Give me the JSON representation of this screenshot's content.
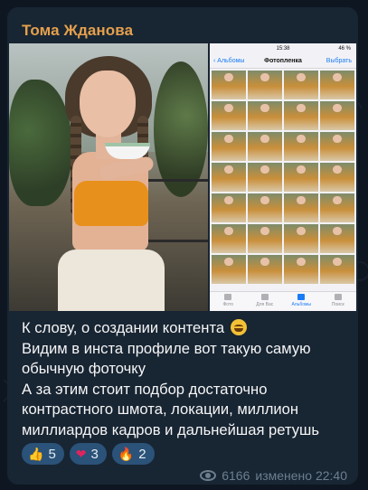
{
  "post": {
    "author": "Тома Жданова",
    "text_lines": [
      "К слову, о создании контента",
      "Видим в инста профиле вот такую самую",
      "обычную фоточку",
      "А за этим стоит подбор достаточно",
      "контрастного шмота, локации, миллион",
      "миллиардов кадров и дальнейшая ретушь"
    ],
    "emoji_icon": "laughing-face-icon",
    "views": "6166",
    "edited_time": "изменено 22:40"
  },
  "media": {
    "phone_screen": {
      "status_time": "15:38",
      "battery": "46 %",
      "back_label": "Альбомы",
      "title": "Фотопленка",
      "select_label": "Выбрать",
      "tabs": [
        "Фото",
        "Для Вас",
        "Альбомы",
        "Поиск"
      ]
    }
  },
  "reactions": [
    {
      "icon": "thumbs-up-icon",
      "glyph": "👍",
      "count": "5"
    },
    {
      "icon": "heart-icon",
      "glyph": "❤",
      "count": "3"
    },
    {
      "icon": "fire-icon",
      "glyph": "🔥",
      "count": "2"
    }
  ],
  "colors": {
    "author": "#e5a04c",
    "bubble": "#182533",
    "reaction_bg": "#2b5278"
  }
}
